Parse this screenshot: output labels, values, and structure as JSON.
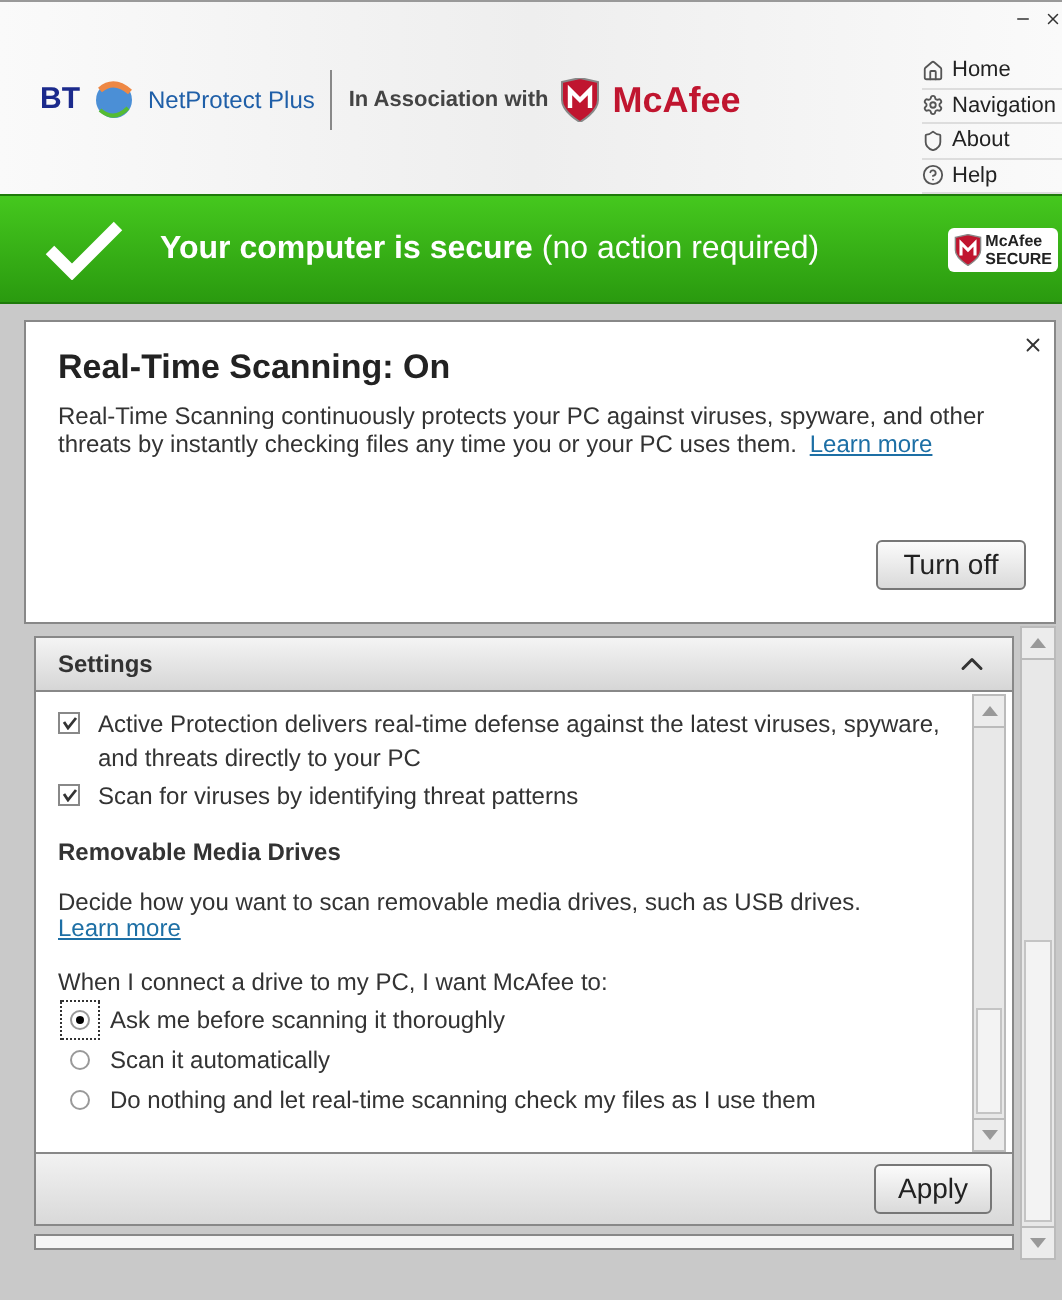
{
  "header": {
    "brand": "BT",
    "product": "NetProtect Plus",
    "association": "In Association with",
    "partner": "McAfee",
    "nav": [
      {
        "label": "Home",
        "kind": "home"
      },
      {
        "label": "Navigation",
        "kind": "gear"
      },
      {
        "label": "About",
        "kind": "shield"
      },
      {
        "label": "Help",
        "kind": "help"
      }
    ]
  },
  "status": {
    "headline": "Your computer is secure",
    "note": "(no action required)",
    "badge": [
      "McAfee",
      "SECURE"
    ]
  },
  "feature": {
    "title": "Real-Time Scanning: On",
    "description": "Real-Time Scanning continuously protects your PC against viruses, spyware, and other threats by instantly checking files any time you or your PC uses them.",
    "link": "Learn more",
    "button": "Turn off"
  },
  "settings": {
    "title": "Settings",
    "expanded": true,
    "options": [
      {
        "label": "Active Protection delivers real-time defense against the latest viruses, spyware, and threats directly to your PC",
        "checked": true
      },
      {
        "label": "Scan for viruses by identifying threat patterns",
        "checked": true
      }
    ],
    "section_title": "Removable Media Drives",
    "section_text": "Decide how you want to scan removable media drives, such as USB drives.",
    "section_link": "Learn more",
    "question": "When I connect a drive to my PC, I want McAfee to:",
    "choices": [
      {
        "label": "Ask me before scanning it thoroughly",
        "selected": true
      },
      {
        "label": "Scan it automatically",
        "selected": false
      },
      {
        "label": "Do nothing and let real-time scanning check my files as I use them",
        "selected": false
      }
    ],
    "button": "Apply"
  }
}
